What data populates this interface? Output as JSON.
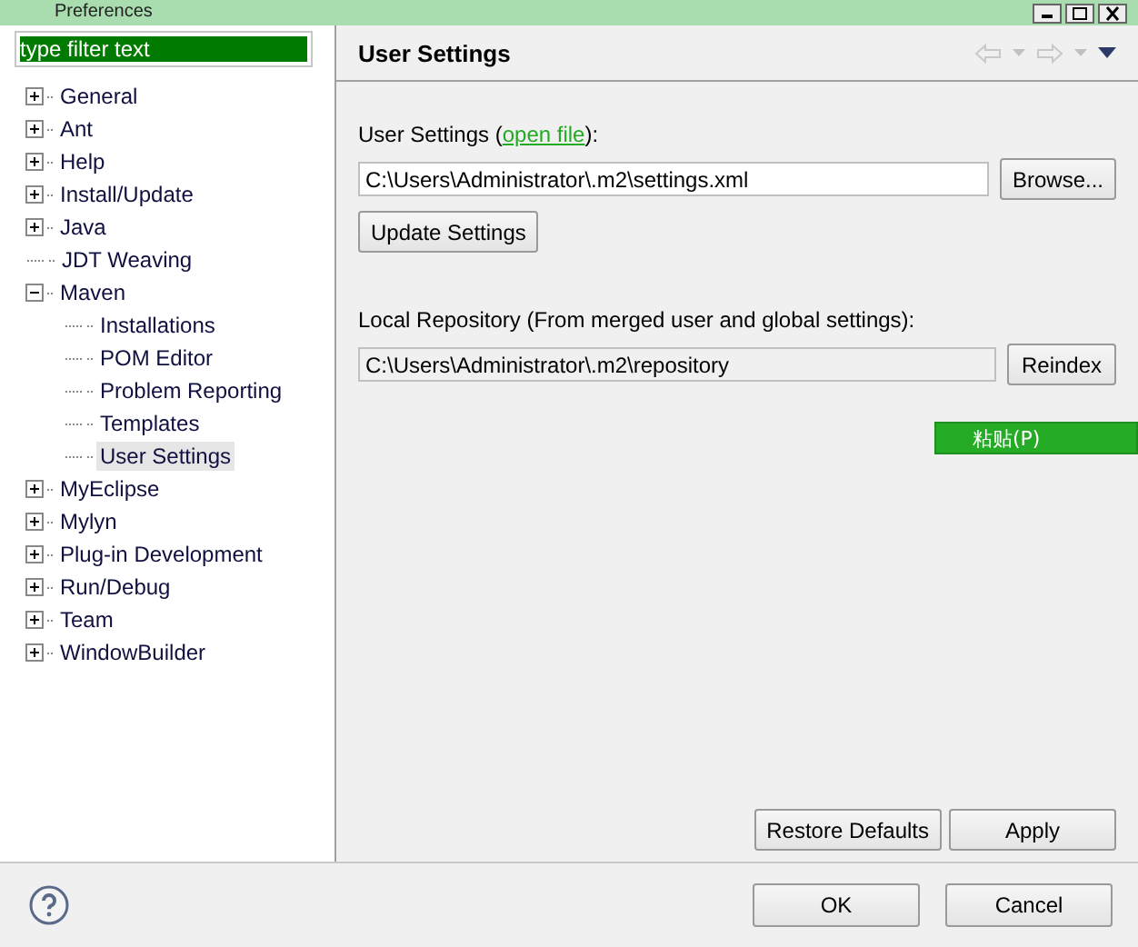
{
  "window": {
    "title": "Preferences"
  },
  "filter": {
    "placeholder": "type filter text"
  },
  "tree": [
    {
      "label": "General",
      "kind": "branch",
      "expanded": false,
      "selected": false
    },
    {
      "label": "Ant",
      "kind": "branch",
      "expanded": false,
      "selected": false
    },
    {
      "label": "Help",
      "kind": "branch",
      "expanded": false,
      "selected": false
    },
    {
      "label": "Install/Update",
      "kind": "branch",
      "expanded": false,
      "selected": false
    },
    {
      "label": "Java",
      "kind": "branch",
      "expanded": false,
      "selected": false
    },
    {
      "label": "JDT Weaving",
      "kind": "leaf",
      "selected": false
    },
    {
      "label": "Maven",
      "kind": "branch",
      "expanded": true,
      "selected": false,
      "children": [
        {
          "label": "Installations",
          "kind": "leaf",
          "selected": false
        },
        {
          "label": "POM Editor",
          "kind": "leaf",
          "selected": false
        },
        {
          "label": "Problem Reporting",
          "kind": "leaf",
          "selected": false
        },
        {
          "label": "Templates",
          "kind": "leaf",
          "selected": false
        },
        {
          "label": "User Settings",
          "kind": "leaf",
          "selected": true
        }
      ]
    },
    {
      "label": "MyEclipse",
      "kind": "branch",
      "expanded": false,
      "selected": false
    },
    {
      "label": "Mylyn",
      "kind": "branch",
      "expanded": false,
      "selected": false
    },
    {
      "label": "Plug-in Development",
      "kind": "branch",
      "expanded": false,
      "selected": false
    },
    {
      "label": "Run/Debug",
      "kind": "branch",
      "expanded": false,
      "selected": false
    },
    {
      "label": "Team",
      "kind": "branch",
      "expanded": false,
      "selected": false
    },
    {
      "label": "WindowBuilder",
      "kind": "branch",
      "expanded": false,
      "selected": false
    }
  ],
  "page": {
    "title": "User Settings",
    "user_settings": {
      "label_before": "User Settings (",
      "link": "open file",
      "label_after": "):",
      "value": "C:\\Users\\Administrator\\.m2\\settings.xml",
      "browse": "Browse...",
      "update": "Update Settings"
    },
    "local_repository": {
      "label": "Local Repository (From merged user and global settings):",
      "value": "C:\\Users\\Administrator\\.m2\\repository",
      "reindex": "Reindex"
    },
    "buttons": [
      "Restore Defaults",
      "Apply"
    ]
  },
  "context_menu": {
    "item": "粘贴(P)"
  },
  "dialog_buttons": [
    "OK",
    "Cancel"
  ]
}
